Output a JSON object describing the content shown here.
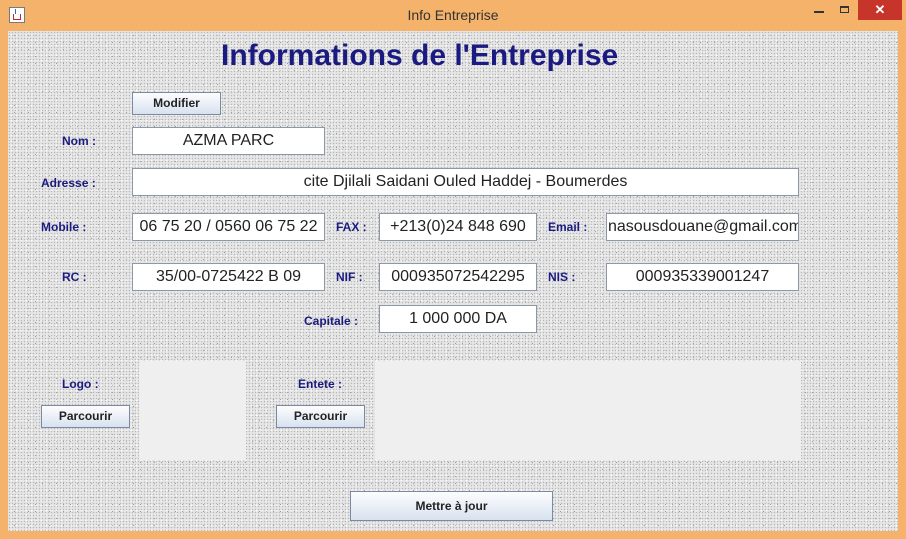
{
  "window": {
    "title": "Info Entreprise",
    "icon": "java-cup-icon",
    "controls": {
      "minimize": "minimize-icon",
      "maximize": "maximize-icon",
      "close": "close-icon"
    }
  },
  "form": {
    "heading": "Informations de l'Entreprise",
    "modifier_button": "Modifier",
    "labels": {
      "nom": "Nom :",
      "adresse": "Adresse :",
      "mobile": "Mobile :",
      "fax": "FAX :",
      "email": "Email :",
      "rc": "RC :",
      "nif": "NIF :",
      "nis": "NIS :",
      "capitale": "Capitale :",
      "logo": "Logo :",
      "entete": "Entete :"
    },
    "values": {
      "nom": "AZMA PARC",
      "adresse": "cite Djilali Saidani Ouled Haddej - Boumerdes",
      "mobile": "06 75 20 / 0560 06 75 22",
      "fax": "+213(0)24 848 690",
      "email": "nasousdouane@gmail.com",
      "rc": "35/00-0725422 B 09",
      "nif": "000935072542295",
      "nis": "000935339001247",
      "capitale": "1 000 000 DA"
    },
    "logo_browse_button": "Parcourir",
    "entete_browse_button": "Parcourir",
    "update_button": "Mettre à jour"
  }
}
